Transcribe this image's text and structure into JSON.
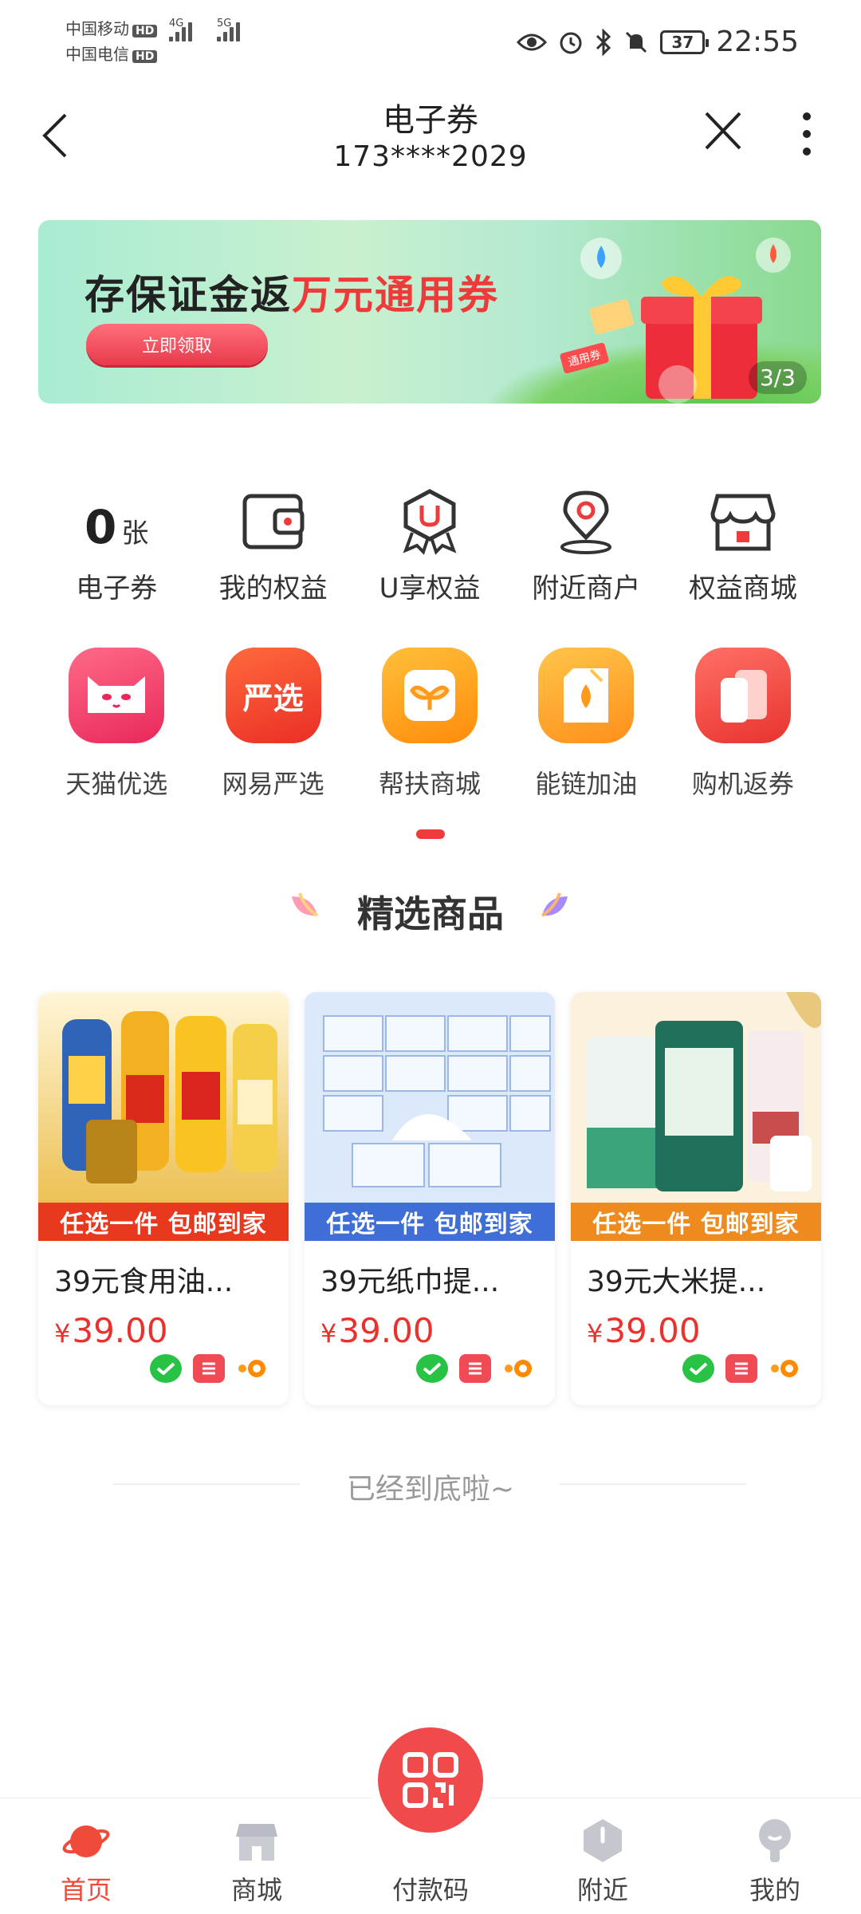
{
  "status_bar": {
    "carrier1": "中国移动",
    "carrier2": "中国电信",
    "hd": "HD",
    "net1": "4G",
    "net2": "5G",
    "battery": "37",
    "time": "22:55"
  },
  "header": {
    "title": "电子券",
    "phone": "173****2029"
  },
  "banner": {
    "title_prefix": "存保证金返",
    "title_highlight": "万元通用券",
    "button": "立即领取",
    "pager": "3/3",
    "tag": "通用券"
  },
  "quick_entries": [
    {
      "label": "电子券",
      "count": "0",
      "unit": "张"
    },
    {
      "label": "我的权益",
      "icon": "wallet-icon"
    },
    {
      "label": "U享权益",
      "icon": "u-badge-icon"
    },
    {
      "label": "附近商户",
      "icon": "location-pin-icon"
    },
    {
      "label": "权益商城",
      "icon": "store-icon"
    }
  ],
  "apps": [
    {
      "label": "天猫优选",
      "icon": "tmall-icon",
      "color": "#f0436a"
    },
    {
      "label": "网易严选",
      "icon": "yanxuan-icon",
      "text": "严选",
      "color": "#f0432e"
    },
    {
      "label": "帮扶商城",
      "icon": "sprout-icon",
      "color": "#ffa318"
    },
    {
      "label": "能链加油",
      "icon": "fuel-icon",
      "color": "#ffa52a"
    },
    {
      "label": "购机返券",
      "icon": "phones-icon",
      "color": "#f2504a"
    }
  ],
  "section_title": "精选商品",
  "products": [
    {
      "strip": "任选一件 包邮到家",
      "name": "39元食用油...",
      "currency": "¥",
      "price": "39.00",
      "strip_color": "#e8391f"
    },
    {
      "strip": "任选一件 包邮到家",
      "name": "39元纸巾提...",
      "currency": "¥",
      "price": "39.00",
      "strip_color": "#3f6fd6"
    },
    {
      "strip": "任选一件 包邮到家",
      "name": "39元大米提...",
      "currency": "¥",
      "price": "39.00",
      "strip_color": "#ef8a1e"
    }
  ],
  "end_text": "已经到底啦~",
  "nav": {
    "home": "首页",
    "mall": "商城",
    "pay": "付款码",
    "nearby": "附近",
    "mine": "我的"
  }
}
